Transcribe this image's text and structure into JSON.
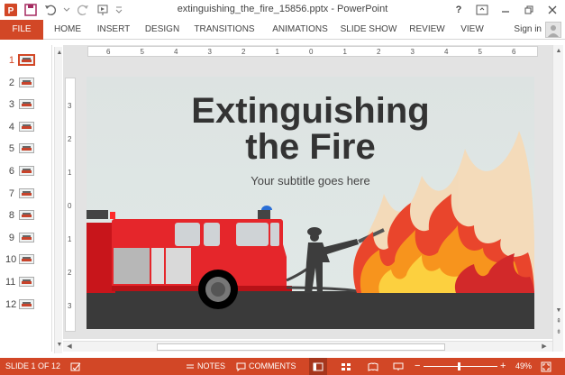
{
  "app": {
    "file_name": "extinguishing_the_fire_15856.pptx",
    "separator": " - ",
    "app_name": "PowerPoint"
  },
  "window": {
    "help": "?"
  },
  "ribbon": {
    "tabs": [
      "FILE",
      "HOME",
      "INSERT",
      "DESIGN",
      "TRANSITIONS",
      "ANIMATIONS",
      "SLIDE SHOW",
      "REVIEW",
      "VIEW"
    ],
    "sign_in": "Sign in"
  },
  "thumbnails": {
    "selected_index": 0,
    "numbers": [
      "1",
      "2",
      "3",
      "4",
      "5",
      "6",
      "7",
      "8",
      "9",
      "10",
      "11",
      "12"
    ]
  },
  "rulers": {
    "horizontal": [
      "6",
      "5",
      "4",
      "3",
      "2",
      "1",
      "0",
      "1",
      "2",
      "3",
      "4",
      "5",
      "6"
    ],
    "vertical": [
      "3",
      "2",
      "1",
      "0",
      "1",
      "2",
      "3"
    ]
  },
  "slide": {
    "title_line1": "Extinguishing",
    "title_line2": "the Fire",
    "subtitle": "Your subtitle goes here"
  },
  "statusbar": {
    "slide_info": "SLIDE 1 OF 12",
    "notes": "NOTES",
    "comments": "COMMENTS",
    "zoom_minus": "−",
    "zoom_plus": "+",
    "zoom": "49%"
  },
  "colors": {
    "accent": "#d24726",
    "truck_red": "#e5262b",
    "fire_orange": "#f7941d",
    "fire_yellow": "#fcd03f"
  }
}
